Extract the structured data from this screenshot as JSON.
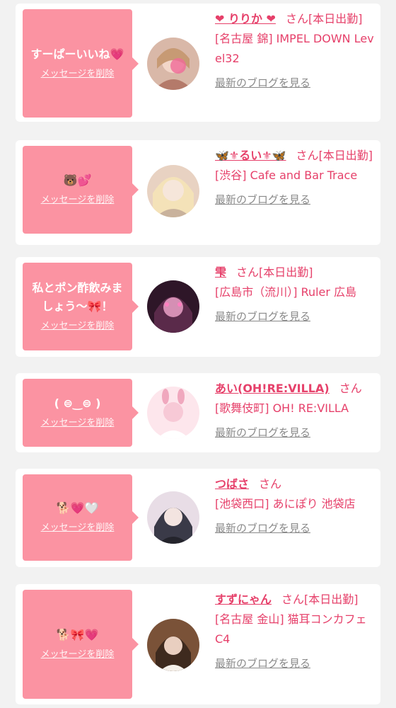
{
  "labels": {
    "delete_message": "メッセージを削除",
    "latest_blog": "最新のブログを見る",
    "honorific": "さん"
  },
  "messages": [
    {
      "bubble_text": "すーぱーいいね💗",
      "cast_name": "❤ りりか ❤",
      "status": "[本日出勤]",
      "shop": "[名古屋 錦] IMPEL DOWN Level32",
      "avatar_colors": [
        "#d9b8a8",
        "#f2d6c8",
        "#b47a6a"
      ]
    },
    {
      "bubble_text": "🐻💕",
      "cast_name": "🦋⚜るい⚜🦋",
      "status": "[本日出勤]",
      "shop": "[渋谷] Cafe and Bar Trace",
      "avatar_colors": [
        "#e8d2c2",
        "#f6e6da",
        "#c9b29c"
      ]
    },
    {
      "bubble_text": "私とポン酢飲みましょう〜🎀！",
      "cast_name": "雫",
      "status": "[本日出勤]",
      "shop": "[広島市（流川）] Ruler 広島",
      "avatar_colors": [
        "#5a2a4a",
        "#d58fb4",
        "#2e1628"
      ]
    },
    {
      "bubble_text": "( ⊜‿⊜ )",
      "cast_name": "あい(OH!RE:VILLA)",
      "status": "",
      "shop": "[歌舞伎町] OH! RE:VILLA",
      "avatar_colors": [
        "#f7c9d6",
        "#fde6ec",
        "#f0a8be"
      ]
    },
    {
      "bubble_text": "🐕💗🤍",
      "cast_name": "つばさ",
      "status": "",
      "shop": "[池袋西口] あにぽり 池袋店",
      "avatar_colors": [
        "#3a3a48",
        "#e8dde6",
        "#24242c"
      ]
    },
    {
      "bubble_text": "🐕🎀💗",
      "cast_name": "すずにゃん",
      "status": "[本日出勤]",
      "shop": "[名古屋 金山] 猫耳コンカフェ C4",
      "avatar_colors": [
        "#7a5238",
        "#e9cfc0",
        "#3e2a1e"
      ]
    }
  ]
}
